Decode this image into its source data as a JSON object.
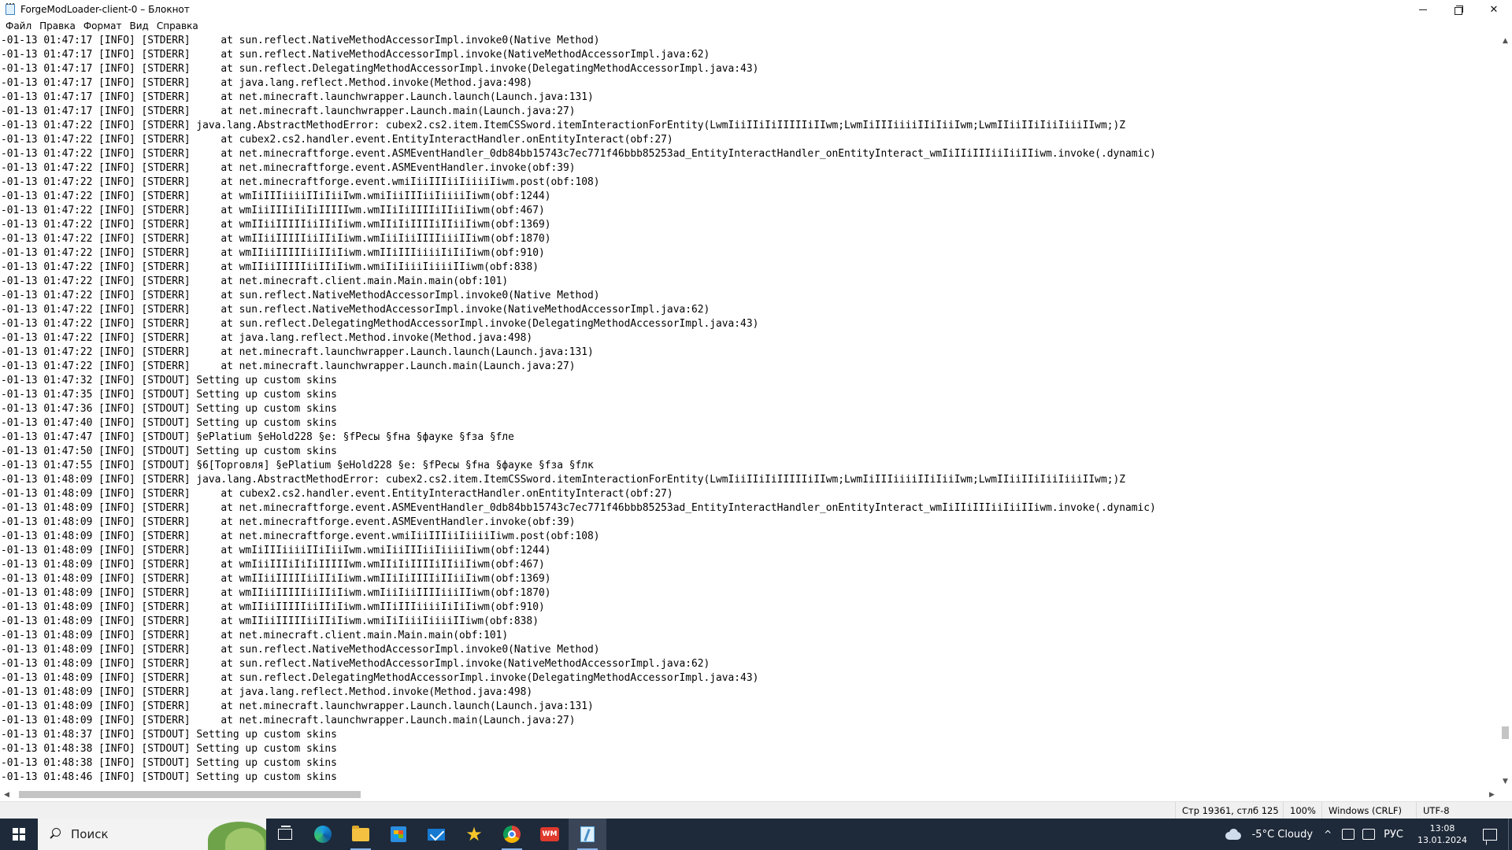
{
  "window": {
    "title": "ForgeModLoader-client-0 – Блокнот"
  },
  "menu": {
    "items": [
      "Файл",
      "Правка",
      "Формат",
      "Вид",
      "Справка"
    ]
  },
  "editor": {
    "lines": [
      "-01-13 01:47:17 [INFO] [STDERR]     at sun.reflect.NativeMethodAccessorImpl.invoke0(Native Method)",
      "-01-13 01:47:17 [INFO] [STDERR]     at sun.reflect.NativeMethodAccessorImpl.invoke(NativeMethodAccessorImpl.java:62)",
      "-01-13 01:47:17 [INFO] [STDERR]     at sun.reflect.DelegatingMethodAccessorImpl.invoke(DelegatingMethodAccessorImpl.java:43)",
      "-01-13 01:47:17 [INFO] [STDERR]     at java.lang.reflect.Method.invoke(Method.java:498)",
      "-01-13 01:47:17 [INFO] [STDERR]     at net.minecraft.launchwrapper.Launch.launch(Launch.java:131)",
      "-01-13 01:47:17 [INFO] [STDERR]     at net.minecraft.launchwrapper.Launch.main(Launch.java:27)",
      "-01-13 01:47:22 [INFO] [STDERR] java.lang.AbstractMethodError: cubex2.cs2.item.ItemCSSword.itemInteractionForEntity(LwmIiiIIiIiIIIIIiIIwm;LwmIiIIIiiiiIIiIiiIwm;LwmIIiiIIiIiiIiiiIIwm;)Z",
      "-01-13 01:47:22 [INFO] [STDERR]     at cubex2.cs2.handler.event.EntityInteractHandler.onEntityInteract(obf:27)",
      "-01-13 01:47:22 [INFO] [STDERR]     at net.minecraftforge.event.ASMEventHandler_0db84bb15743c7ec771f46bbb85253ad_EntityInteractHandler_onEntityInteract_wmIiIIiIIIiiIiiIIiwm.invoke(.dynamic)",
      "-01-13 01:47:22 [INFO] [STDERR]     at net.minecraftforge.event.ASMEventHandler.invoke(obf:39)",
      "-01-13 01:47:22 [INFO] [STDERR]     at net.minecraftforge.event.wmiIiiIIIiiIiiiiIiwm.post(obf:108)",
      "-01-13 01:47:22 [INFO] [STDERR]     at wmIiIIIiiiiIIiIiiIwm.wmiIiiIIIiiIiiiiIiwm(obf:1244)",
      "-01-13 01:47:22 [INFO] [STDERR]     at wmIiiIIIiIiIiIIIIIwm.wmIIiIiIIIIiIIiiIiwm(obf:467)",
      "-01-13 01:47:22 [INFO] [STDERR]     at wmIIiiIIIIIiiIIiIiwm.wmIIiIiIIIIiIIiiIiwm(obf:1369)",
      "-01-13 01:47:22 [INFO] [STDERR]     at wmIIiiIIIIIiiIIiIiwm.wmIiiIiiIIIIiiiIIiwm(obf:1870)",
      "-01-13 01:47:22 [INFO] [STDERR]     at wmIIiiIIIIIiiIIiIiwm.wmIIiIIIiiiiIiIiIiwm(obf:910)",
      "-01-13 01:47:22 [INFO] [STDERR]     at wmIIiiIIIIIiiIIiIiwm.wmiIiIiiiIiiiiIIiwm(obf:838)",
      "-01-13 01:47:22 [INFO] [STDERR]     at net.minecraft.client.main.Main.main(obf:101)",
      "-01-13 01:47:22 [INFO] [STDERR]     at sun.reflect.NativeMethodAccessorImpl.invoke0(Native Method)",
      "-01-13 01:47:22 [INFO] [STDERR]     at sun.reflect.NativeMethodAccessorImpl.invoke(NativeMethodAccessorImpl.java:62)",
      "-01-13 01:47:22 [INFO] [STDERR]     at sun.reflect.DelegatingMethodAccessorImpl.invoke(DelegatingMethodAccessorImpl.java:43)",
      "-01-13 01:47:22 [INFO] [STDERR]     at java.lang.reflect.Method.invoke(Method.java:498)",
      "-01-13 01:47:22 [INFO] [STDERR]     at net.minecraft.launchwrapper.Launch.launch(Launch.java:131)",
      "-01-13 01:47:22 [INFO] [STDERR]     at net.minecraft.launchwrapper.Launch.main(Launch.java:27)",
      "-01-13 01:47:32 [INFO] [STDOUT] Setting up custom skins",
      "-01-13 01:47:35 [INFO] [STDOUT] Setting up custom skins",
      "-01-13 01:47:36 [INFO] [STDOUT] Setting up custom skins",
      "-01-13 01:47:40 [INFO] [STDOUT] Setting up custom skins",
      "-01-13 01:47:47 [INFO] [STDOUT] §ePlatium §eHold228 §e: §fРесы §fна §фауке §fза §fле",
      "-01-13 01:47:50 [INFO] [STDOUT] Setting up custom skins",
      "-01-13 01:47:55 [INFO] [STDOUT] §6[Торговля] §ePlatium §eHold228 §e: §fРесы §fна §фауке §fза §fлк",
      "-01-13 01:48:09 [INFO] [STDERR] java.lang.AbstractMethodError: cubex2.cs2.item.ItemCSSword.itemInteractionForEntity(LwmIiiIIiIiIIIIIiIIwm;LwmIiIIIiiiiIIiIiiIwm;LwmIIiiIIiIiiIiiiIIwm;)Z",
      "-01-13 01:48:09 [INFO] [STDERR]     at cubex2.cs2.handler.event.EntityInteractHandler.onEntityInteract(obf:27)",
      "-01-13 01:48:09 [INFO] [STDERR]     at net.minecraftforge.event.ASMEventHandler_0db84bb15743c7ec771f46bbb85253ad_EntityInteractHandler_onEntityInteract_wmIiIIiIIIiiIiiIIiwm.invoke(.dynamic)",
      "-01-13 01:48:09 [INFO] [STDERR]     at net.minecraftforge.event.ASMEventHandler.invoke(obf:39)",
      "-01-13 01:48:09 [INFO] [STDERR]     at net.minecraftforge.event.wmiIiiIIIiiIiiiiIiwm.post(obf:108)",
      "-01-13 01:48:09 [INFO] [STDERR]     at wmIiIIIiiiiIIiIiiIwm.wmiIiiIIIiiIiiiiIiwm(obf:1244)",
      "-01-13 01:48:09 [INFO] [STDERR]     at wmIiiIIIiIiIiIIIIIwm.wmIIiIiIIIIiIIiiIiwm(obf:467)",
      "-01-13 01:48:09 [INFO] [STDERR]     at wmIIiiIIIIIiiIIiIiwm.wmIIiIiIIIIiIIiiIiwm(obf:1369)",
      "-01-13 01:48:09 [INFO] [STDERR]     at wmIIiiIIIIIiiIIiIiwm.wmIiiIiiIIIIiiiIIiwm(obf:1870)",
      "-01-13 01:48:09 [INFO] [STDERR]     at wmIIiiIIIIIiiIIiIiwm.wmIIiIIIiiiiIiIiIiwm(obf:910)",
      "-01-13 01:48:09 [INFO] [STDERR]     at wmIIiiIIIIIiiIIiIiwm.wmiIiIiiiIiiiiIIiwm(obf:838)",
      "-01-13 01:48:09 [INFO] [STDERR]     at net.minecraft.client.main.Main.main(obf:101)",
      "-01-13 01:48:09 [INFO] [STDERR]     at sun.reflect.NativeMethodAccessorImpl.invoke0(Native Method)",
      "-01-13 01:48:09 [INFO] [STDERR]     at sun.reflect.NativeMethodAccessorImpl.invoke(NativeMethodAccessorImpl.java:62)",
      "-01-13 01:48:09 [INFO] [STDERR]     at sun.reflect.DelegatingMethodAccessorImpl.invoke(DelegatingMethodAccessorImpl.java:43)",
      "-01-13 01:48:09 [INFO] [STDERR]     at java.lang.reflect.Method.invoke(Method.java:498)",
      "-01-13 01:48:09 [INFO] [STDERR]     at net.minecraft.launchwrapper.Launch.launch(Launch.java:131)",
      "-01-13 01:48:09 [INFO] [STDERR]     at net.minecraft.launchwrapper.Launch.main(Launch.java:27)",
      "-01-13 01:48:37 [INFO] [STDOUT] Setting up custom skins",
      "-01-13 01:48:38 [INFO] [STDOUT] Setting up custom skins",
      "-01-13 01:48:38 [INFO] [STDOUT] Setting up custom skins",
      "-01-13 01:48:46 [INFO] [STDOUT] Setting up custom skins"
    ]
  },
  "statusbar": {
    "position": "Стр 19361, стлб 125",
    "zoom": "100%",
    "line_ending": "Windows (CRLF)",
    "encoding": "UTF-8"
  },
  "taskbar": {
    "search_placeholder": "Поиск",
    "wm_label": "WM",
    "weather": "-5°C  Cloudy",
    "language": "РУС",
    "time": "13:08",
    "date": "13.01.2024"
  },
  "icons": {
    "scroll_up": "▲",
    "scroll_down": "▼",
    "scroll_left": "◀",
    "scroll_right": "▶",
    "chevron_up": "^",
    "favorites": "★"
  }
}
